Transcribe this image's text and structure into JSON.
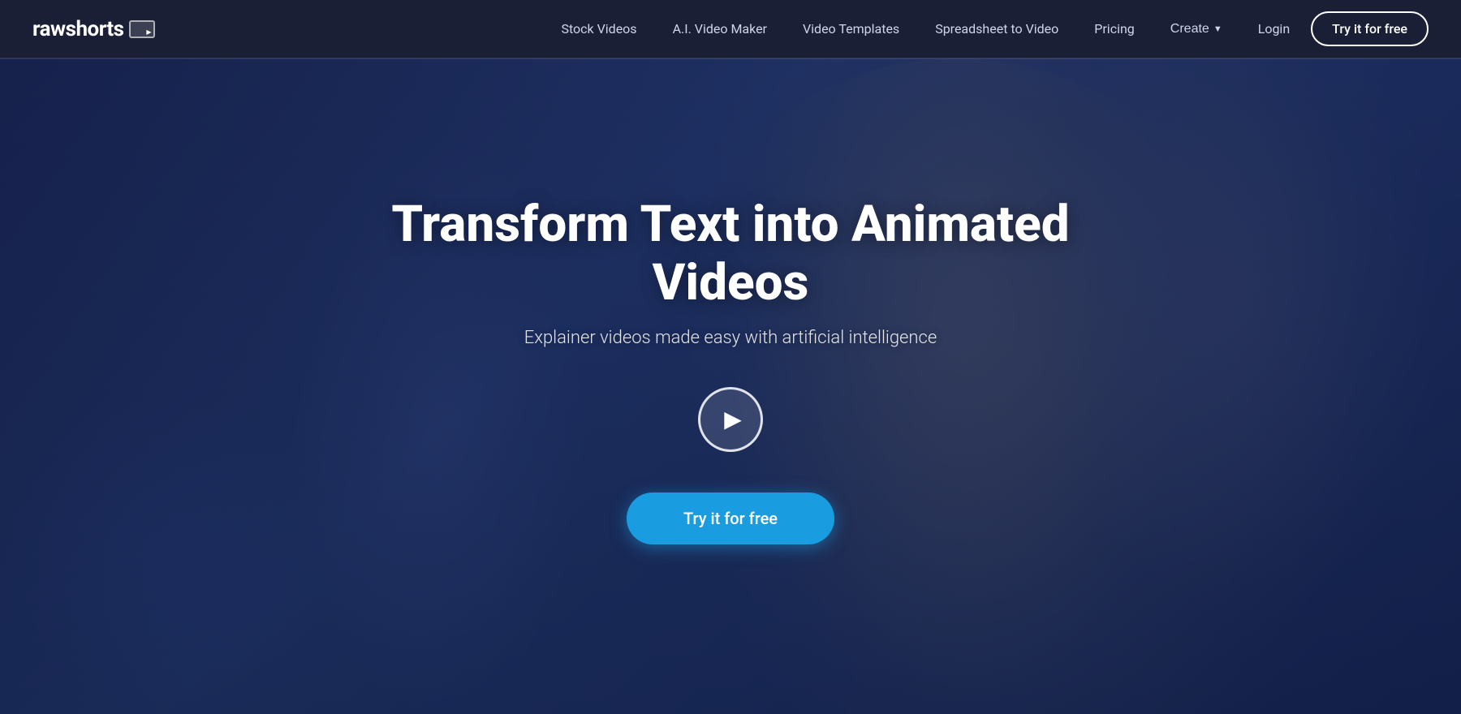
{
  "brand": {
    "name_part1": "raw",
    "name_part2": "shorts"
  },
  "navbar": {
    "links": [
      {
        "id": "stock-videos",
        "label": "Stock Videos",
        "has_dropdown": false
      },
      {
        "id": "ai-video-maker",
        "label": "A.I. Video Maker",
        "has_dropdown": false
      },
      {
        "id": "video-templates",
        "label": "Video Templates",
        "has_dropdown": false
      },
      {
        "id": "spreadsheet-to-video",
        "label": "Spreadsheet to Video",
        "has_dropdown": false
      },
      {
        "id": "pricing",
        "label": "Pricing",
        "has_dropdown": false
      },
      {
        "id": "create",
        "label": "Create",
        "has_dropdown": true
      }
    ],
    "login_label": "Login",
    "try_free_label": "Try it for free"
  },
  "hero": {
    "title": "Transform Text into Animated Videos",
    "subtitle": "Explainer videos made easy with artificial intelligence",
    "cta_label": "Try it for free",
    "play_aria": "Play video"
  },
  "colors": {
    "navbar_bg": "#1a1f36",
    "cta_bg": "#1a9de0",
    "accent_border": "#ffffff"
  }
}
